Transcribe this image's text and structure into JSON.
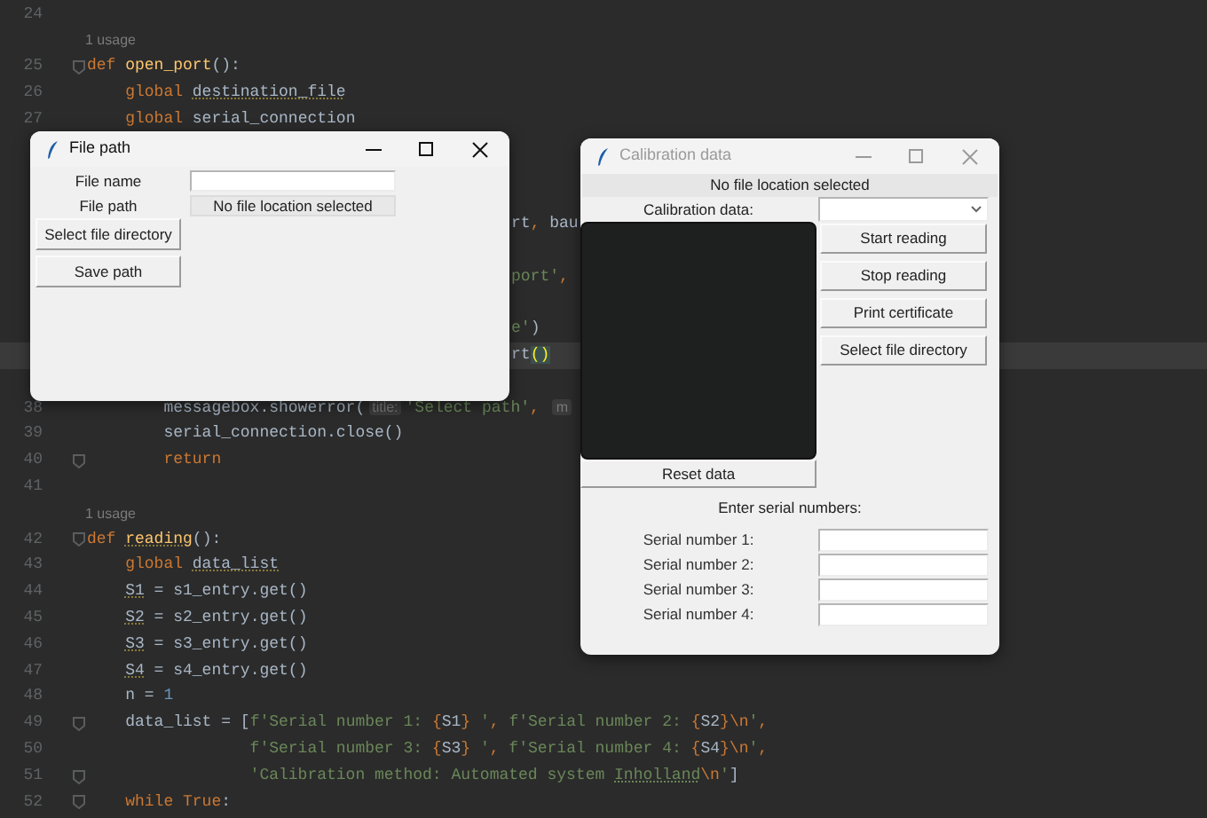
{
  "editor": {
    "lines": [
      {
        "kind": "code",
        "number": "24",
        "fold": false,
        "current": false
      },
      {
        "kind": "usage",
        "text": "1 usage"
      },
      {
        "kind": "code",
        "number": "25",
        "fold": true,
        "current": false,
        "tokens": [
          {
            "text": "def ",
            "kind": "kw"
          },
          {
            "text": "open_port",
            "kind": "fn"
          },
          {
            "text": "():",
            "kind": "plain"
          }
        ]
      },
      {
        "kind": "code",
        "number": "26",
        "fold": false,
        "current": false,
        "tokens": [
          {
            "text": "    global ",
            "kind": "kw"
          },
          {
            "text": "destination_file",
            "kind": "warn"
          }
        ]
      },
      {
        "kind": "code",
        "number": "27",
        "fold": false,
        "current": false,
        "tokens": [
          {
            "text": "    global ",
            "kind": "kw"
          },
          {
            "text": "serial_connection",
            "kind": "plain"
          }
        ]
      },
      {
        "kind": "covered",
        "current": false
      },
      {
        "kind": "covered",
        "current": false
      },
      {
        "kind": "covered",
        "current": false
      },
      {
        "kind": "covered",
        "current": false,
        "tokens": [
          {
            "text": "rt",
            "kind": "plain"
          },
          {
            "text": ", ",
            "kind": "sep"
          },
          {
            "text": "bau",
            "kind": "plain"
          }
        ]
      },
      {
        "kind": "covered",
        "current": false
      },
      {
        "kind": "covered",
        "current": false,
        "tokens": [
          {
            "text": "port'",
            "kind": "str"
          },
          {
            "text": ",",
            "kind": "sep"
          }
        ]
      },
      {
        "kind": "covered",
        "current": false
      },
      {
        "kind": "covered",
        "current": false,
        "tokens": [
          {
            "text": "e'",
            "kind": "str"
          },
          {
            "text": ")",
            "kind": "plain"
          }
        ]
      },
      {
        "kind": "covered",
        "current": true,
        "tokens": [
          {
            "text": "rt",
            "kind": "plain"
          },
          {
            "text": "()",
            "kind": "match"
          }
        ]
      },
      {
        "kind": "covered",
        "current": false
      },
      {
        "kind": "code",
        "number": "38",
        "fold": false,
        "current": false,
        "tokens": [
          {
            "text": "        messagebox.showerror(",
            "kind": "plain"
          },
          {
            "text": "title:",
            "kind": "hint"
          },
          {
            "text": "'Select path'",
            "kind": "str"
          },
          {
            "text": ", ",
            "kind": "sep"
          },
          {
            "text": "m",
            "kind": "hint"
          }
        ]
      },
      {
        "kind": "code",
        "number": "39",
        "fold": false,
        "current": false,
        "tokens": [
          {
            "text": "        serial_connection.close()",
            "kind": "plain"
          }
        ]
      },
      {
        "kind": "code",
        "number": "40",
        "fold": true,
        "current": false,
        "tokens": [
          {
            "text": "        return",
            "kind": "kw"
          }
        ]
      },
      {
        "kind": "code",
        "number": "41",
        "fold": false,
        "current": false
      },
      {
        "kind": "usage",
        "text": "1 usage"
      },
      {
        "kind": "code",
        "number": "42",
        "fold": true,
        "current": false,
        "tokens": [
          {
            "text": "def ",
            "kind": "kw"
          },
          {
            "text": "reading",
            "kind": "fnwarn"
          },
          {
            "text": "():",
            "kind": "plain"
          }
        ]
      },
      {
        "kind": "code",
        "number": "43",
        "fold": false,
        "current": false,
        "tokens": [
          {
            "text": "    global ",
            "kind": "kw"
          },
          {
            "text": "data_list",
            "kind": "warn"
          }
        ]
      },
      {
        "kind": "code",
        "number": "44",
        "fold": false,
        "current": false,
        "tokens": [
          {
            "text": "    S1",
            "kind": "warn"
          },
          {
            "text": " = s1_entry.get()",
            "kind": "plain"
          }
        ]
      },
      {
        "kind": "code",
        "number": "45",
        "fold": false,
        "current": false,
        "tokens": [
          {
            "text": "    S2",
            "kind": "warn"
          },
          {
            "text": " = s2_entry.get()",
            "kind": "plain"
          }
        ]
      },
      {
        "kind": "code",
        "number": "46",
        "fold": false,
        "current": false,
        "tokens": [
          {
            "text": "    S3",
            "kind": "warn"
          },
          {
            "text": " = s3_entry.get()",
            "kind": "plain"
          }
        ]
      },
      {
        "kind": "code",
        "number": "47",
        "fold": false,
        "current": false,
        "tokens": [
          {
            "text": "    S4",
            "kind": "warn"
          },
          {
            "text": " = s4_entry.get()",
            "kind": "plain"
          }
        ]
      },
      {
        "kind": "code",
        "number": "48",
        "fold": false,
        "current": false,
        "tokens": [
          {
            "text": "    n = ",
            "kind": "plain"
          },
          {
            "text": "1",
            "kind": "num"
          }
        ]
      },
      {
        "kind": "code",
        "number": "49",
        "fold": true,
        "current": false,
        "tokens": [
          {
            "text": "    data_list = [",
            "kind": "plain"
          },
          {
            "text": "f'Serial number 1: ",
            "kind": "str"
          },
          {
            "text": "{",
            "kind": "brace"
          },
          {
            "text": "S1",
            "kind": "plain"
          },
          {
            "text": "}",
            "kind": "brace"
          },
          {
            "text": " '",
            "kind": "str"
          },
          {
            "text": ", ",
            "kind": "sep"
          },
          {
            "text": "f'Serial number 2: ",
            "kind": "str"
          },
          {
            "text": "{",
            "kind": "brace"
          },
          {
            "text": "S2",
            "kind": "plain"
          },
          {
            "text": "}",
            "kind": "brace"
          },
          {
            "text": "\\n",
            "kind": "brace"
          },
          {
            "text": "'",
            "kind": "str"
          },
          {
            "text": ",",
            "kind": "sep"
          }
        ]
      },
      {
        "kind": "code",
        "number": "50",
        "fold": false,
        "current": false,
        "tokens": [
          {
            "text": "                 f'Serial number 3: ",
            "kind": "str"
          },
          {
            "text": "{",
            "kind": "brace"
          },
          {
            "text": "S3",
            "kind": "plain"
          },
          {
            "text": "}",
            "kind": "brace"
          },
          {
            "text": " '",
            "kind": "str"
          },
          {
            "text": ", ",
            "kind": "sep"
          },
          {
            "text": "f'Serial number 4: ",
            "kind": "str"
          },
          {
            "text": "{",
            "kind": "brace"
          },
          {
            "text": "S4",
            "kind": "plain"
          },
          {
            "text": "}",
            "kind": "brace"
          },
          {
            "text": "\\n",
            "kind": "brace"
          },
          {
            "text": "'",
            "kind": "str"
          },
          {
            "text": ",",
            "kind": "sep"
          }
        ]
      },
      {
        "kind": "code",
        "number": "51",
        "fold": true,
        "current": false,
        "tokens": [
          {
            "text": "                 'Calibration method: Automated system ",
            "kind": "str"
          },
          {
            "text": "Inholland",
            "kind": "strwarn"
          },
          {
            "text": "\\n",
            "kind": "brace"
          },
          {
            "text": "'",
            "kind": "str"
          },
          {
            "text": "]",
            "kind": "plain"
          }
        ]
      },
      {
        "kind": "code",
        "number": "52",
        "fold": true,
        "current": false,
        "tokens": [
          {
            "text": "    while ",
            "kind": "kw"
          },
          {
            "text": "True",
            "kind": "kw"
          },
          {
            "text": ":",
            "kind": "plain"
          }
        ]
      }
    ]
  },
  "file_path_window": {
    "title": "File path",
    "active": true,
    "file_name": {
      "label": "File name"
    },
    "file_path": {
      "label": "File path",
      "value": "No file location selected"
    },
    "buttons": [
      "Select file directory",
      "Save path"
    ]
  },
  "calibration_window": {
    "title": "Calibration data",
    "active": false,
    "status": "No file location selected",
    "calibration_label": "Calibration data:",
    "action_buttons": [
      "Start reading",
      "Stop reading",
      "Print certificate",
      "Select file directory"
    ],
    "reset_button": "Reset data",
    "serial_heading": "Enter serial numbers:",
    "serial_fields": [
      {
        "label": "Serial number 1:"
      },
      {
        "label": "Serial number 2:"
      },
      {
        "label": "Serial number 3:"
      },
      {
        "label": "Serial number 4:"
      }
    ]
  }
}
